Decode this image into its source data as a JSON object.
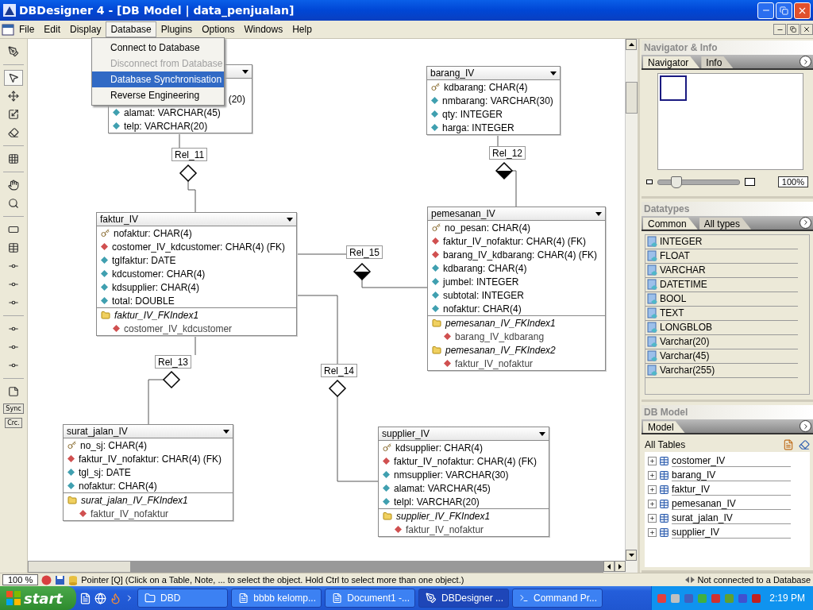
{
  "window": {
    "title": "DBDesigner 4 - [DB Model | data_penjualan]"
  },
  "menu": [
    {
      "label": "File",
      "selected": false
    },
    {
      "label": "Edit",
      "selected": false
    },
    {
      "label": "Display",
      "selected": false
    },
    {
      "label": "Database",
      "selected": true
    },
    {
      "label": "Plugins",
      "selected": false
    },
    {
      "label": "Options",
      "selected": false
    },
    {
      "label": "Windows",
      "selected": false
    },
    {
      "label": "Help",
      "selected": false
    }
  ],
  "open_menu": {
    "items": [
      {
        "label": "Connect to Database",
        "disabled": false,
        "selected": false
      },
      {
        "label": "Disconnect from Database",
        "disabled": true,
        "selected": false
      },
      {
        "label": "Database Synchronisation",
        "disabled": false,
        "selected": true
      },
      {
        "label": "Reverse Engineering",
        "disabled": false,
        "selected": false
      }
    ]
  },
  "left_toolbar": {
    "tools": [
      {
        "selected": false
      },
      {
        "selected": true
      },
      {
        "selected": false
      },
      {
        "selected": false
      },
      {
        "selected": false
      },
      {
        "selected": false
      },
      {
        "selected": false
      },
      {
        "selected": false
      },
      {
        "selected": false
      },
      {
        "selected": false
      },
      {
        "selected": false
      },
      {
        "selected": false
      },
      {
        "selected": false
      },
      {
        "selected": false
      },
      {
        "selected": false
      },
      {
        "selected": false
      },
      {
        "selected": false
      }
    ],
    "buttons": [
      "Sync",
      "Crc."
    ]
  },
  "tables": [
    {
      "fields": [
        {
          "kind": "cut",
          "text": "(20)"
        },
        {
          "kind": "field",
          "text": "alamat: VARCHAR(45)"
        },
        {
          "kind": "field",
          "text": "telp: VARCHAR(20)"
        }
      ]
    },
    {
      "title": "barang_IV",
      "fields": [
        {
          "kind": "key",
          "text": "kdbarang: CHAR(4)"
        },
        {
          "kind": "field",
          "text": "nmbarang: VARCHAR(30)"
        },
        {
          "kind": "field",
          "text": "qty: INTEGER"
        },
        {
          "kind": "field",
          "text": "harga: INTEGER"
        }
      ]
    },
    {
      "title": "faktur_IV",
      "fields": [
        {
          "kind": "key",
          "text": "nofaktur: CHAR(4)"
        },
        {
          "kind": "fk",
          "text": "costomer_IV_kdcustomer: CHAR(4) (FK)"
        },
        {
          "kind": "field",
          "text": "tglfaktur: DATE"
        },
        {
          "kind": "field",
          "text": "kdcustomer: CHAR(4)"
        },
        {
          "kind": "field",
          "text": "kdsupplier: CHAR(4)"
        },
        {
          "kind": "field",
          "text": "total: DOUBLE"
        },
        {
          "kind": "index",
          "text": "faktur_IV_FKIndex1"
        },
        {
          "kind": "index-field",
          "text": "costomer_IV_kdcustomer"
        }
      ]
    },
    {
      "title": "pemesanan_IV",
      "fields": [
        {
          "kind": "key",
          "text": "no_pesan: CHAR(4)"
        },
        {
          "kind": "fk",
          "text": "faktur_IV_nofaktur: CHAR(4) (FK)"
        },
        {
          "kind": "fk",
          "text": "barang_IV_kdbarang: CHAR(4) (FK)"
        },
        {
          "kind": "field",
          "text": "kdbarang: CHAR(4)"
        },
        {
          "kind": "field",
          "text": "jumbel: INTEGER"
        },
        {
          "kind": "field",
          "text": "subtotal: INTEGER"
        },
        {
          "kind": "field",
          "text": "nofaktur: CHAR(4)"
        },
        {
          "kind": "index",
          "text": "pemesanan_IV_FKIndex1"
        },
        {
          "kind": "index-field",
          "text": "barang_IV_kdbarang"
        },
        {
          "kind": "index",
          "text": "pemesanan_IV_FKIndex2"
        },
        {
          "kind": "index-field",
          "text": "faktur_IV_nofaktur"
        }
      ]
    },
    {
      "title": "surat_jalan_IV",
      "fields": [
        {
          "kind": "key",
          "text": "no_sj: CHAR(4)"
        },
        {
          "kind": "fk",
          "text": "faktur_IV_nofaktur: CHAR(4) (FK)"
        },
        {
          "kind": "field",
          "text": "tgl_sj: DATE"
        },
        {
          "kind": "field",
          "text": "nofaktur: CHAR(4)"
        },
        {
          "kind": "index",
          "text": "surat_jalan_IV_FKIndex1"
        },
        {
          "kind": "index-field",
          "text": "faktur_IV_nofaktur"
        }
      ]
    },
    {
      "title": "supplier_IV",
      "fields": [
        {
          "kind": "key",
          "text": "kdsupplier: CHAR(4)"
        },
        {
          "kind": "fk",
          "text": "faktur_IV_nofaktur: CHAR(4) (FK)"
        },
        {
          "kind": "field",
          "text": "nmsupplier: VARCHAR(30)"
        },
        {
          "kind": "field",
          "text": "alamat: VARCHAR(45)"
        },
        {
          "kind": "field",
          "text": "telpl: VARCHAR(20)"
        },
        {
          "kind": "index",
          "text": "supplier_IV_FKIndex1"
        },
        {
          "kind": "index-field",
          "text": "faktur_IV_nofaktur"
        }
      ]
    }
  ],
  "relations": [
    {
      "label": "Rel_11",
      "filled": false
    },
    {
      "label": "Rel_12",
      "filled": true
    },
    {
      "label": "Rel_15",
      "filled": true
    },
    {
      "label": "Rel_13",
      "filled": false
    },
    {
      "label": "Rel_14",
      "filled": false
    }
  ],
  "navigator": {
    "title": "Navigator & Info",
    "tabs": [
      {
        "label": "Navigator",
        "selected": true
      },
      {
        "label": "Info",
        "selected": false
      }
    ],
    "zoom": {
      "level": 0.22,
      "value": "100%"
    }
  },
  "datatypes": {
    "title": "Datatypes",
    "tabs": [
      {
        "label": "Common",
        "selected": true
      },
      {
        "label": "All types",
        "selected": false
      }
    ],
    "items": [
      "INTEGER",
      "FLOAT",
      "VARCHAR",
      "DATETIME",
      "BOOL",
      "TEXT",
      "LONGBLOB",
      "Varchar(20)",
      "Varchar(45)",
      "Varchar(255)"
    ]
  },
  "db_model": {
    "title": "DB Model",
    "tabs": [
      {
        "label": "Model",
        "selected": true
      }
    ],
    "heading": "All Tables",
    "items": [
      {
        "label": "costomer_IV",
        "expanded": false
      },
      {
        "label": "barang_IV",
        "expanded": false
      },
      {
        "label": "faktur_IV",
        "expanded": false
      },
      {
        "label": "pemesanan_IV",
        "expanded": false
      },
      {
        "label": "surat_jalan_IV",
        "expanded": false
      },
      {
        "label": "supplier_IV",
        "expanded": false
      }
    ]
  },
  "status_bar": {
    "zoom": "100 %",
    "message": "Pointer [Q] (Click on a Table, Note, ... to select the object. Hold Ctrl to select more than one object.)",
    "connection": "Not connected to a Database"
  },
  "taskbar": {
    "start": "start",
    "tasks": [
      {
        "label": "DBD",
        "selected": false
      },
      {
        "label": "bbbb kelomp...",
        "selected": false
      },
      {
        "label": "Document1 -...",
        "selected": false
      },
      {
        "label": "DBDesigner ...",
        "selected": true
      },
      {
        "label": "Command Pr...",
        "selected": false
      }
    ],
    "clock": "2:19 PM"
  }
}
